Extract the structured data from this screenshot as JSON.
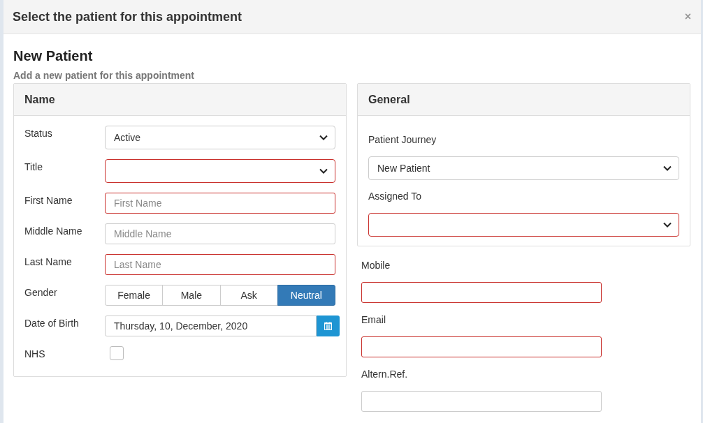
{
  "dialog": {
    "title": "Select the patient for this appointment",
    "close": "×"
  },
  "heading": "New Patient",
  "subtitle": "Add a new patient for this appointment",
  "name_panel": {
    "title": "Name",
    "fields": [
      {
        "kind": "select",
        "label": "Status",
        "value": "Active",
        "invalid": false
      },
      {
        "kind": "select",
        "label": "Title",
        "invalid": true
      },
      {
        "kind": "text",
        "label": "First Name",
        "placeholder": "First Name",
        "invalid": true
      },
      {
        "kind": "text",
        "label": "Middle Name",
        "placeholder": "Middle Name",
        "invalid": false
      },
      {
        "kind": "text",
        "label": "Last Name",
        "placeholder": "Last Name",
        "invalid": true
      },
      {
        "kind": "segmented",
        "label": "Gender",
        "options": [
          {
            "label": "Female",
            "selected": false
          },
          {
            "label": "Male",
            "selected": false
          },
          {
            "label": "Ask",
            "selected": false
          },
          {
            "label": "Neutral",
            "selected": true
          }
        ]
      },
      {
        "kind": "date",
        "label": "Date of Birth",
        "value": "Thursday, 10, December, 2020"
      },
      {
        "kind": "checkbox",
        "label": "NHS",
        "checked": false
      }
    ]
  },
  "general_panel": {
    "title": "General",
    "fields": [
      {
        "kind": "select",
        "label": "Patient Journey",
        "value": "New Patient",
        "invalid": false
      },
      {
        "kind": "select",
        "label": "Assigned To",
        "invalid": true
      }
    ]
  },
  "contact_fields": [
    {
      "label": "Mobile",
      "invalid": true
    },
    {
      "label": "Email",
      "invalid": true
    },
    {
      "label": "Altern.Ref.",
      "invalid": false
    }
  ]
}
